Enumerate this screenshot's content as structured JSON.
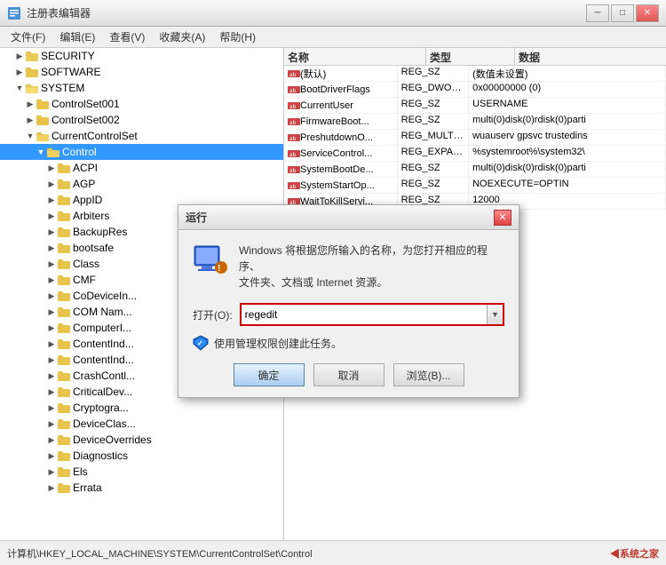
{
  "window": {
    "title": "注册表编辑器",
    "min_label": "─",
    "max_label": "□",
    "close_label": "✕"
  },
  "menu": {
    "items": [
      "文件(F)",
      "编辑(E)",
      "查看(V)",
      "收藏夹(A)",
      "帮助(H)"
    ]
  },
  "tree": {
    "items": [
      {
        "id": "security",
        "label": "SECURITY",
        "indent": 1,
        "expanded": false,
        "selected": false
      },
      {
        "id": "software",
        "label": "SOFTWARE",
        "indent": 1,
        "expanded": false,
        "selected": false
      },
      {
        "id": "system",
        "label": "SYSTEM",
        "indent": 1,
        "expanded": true,
        "selected": false
      },
      {
        "id": "controlset001",
        "label": "ControlSet001",
        "indent": 2,
        "expanded": false,
        "selected": false
      },
      {
        "id": "controlset002",
        "label": "ControlSet002",
        "indent": 2,
        "expanded": false,
        "selected": false
      },
      {
        "id": "currentcontrolset",
        "label": "CurrentControlSet",
        "indent": 2,
        "expanded": true,
        "selected": false
      },
      {
        "id": "control",
        "label": "Control",
        "indent": 3,
        "expanded": true,
        "selected": true
      },
      {
        "id": "acpi",
        "label": "ACPI",
        "indent": 4,
        "expanded": false,
        "selected": false
      },
      {
        "id": "agp",
        "label": "AGP",
        "indent": 4,
        "expanded": false,
        "selected": false
      },
      {
        "id": "appid",
        "label": "AppID",
        "indent": 4,
        "expanded": false,
        "selected": false
      },
      {
        "id": "arbiters",
        "label": "Arbiters",
        "indent": 4,
        "expanded": false,
        "selected": false
      },
      {
        "id": "backupres",
        "label": "BackupRes",
        "indent": 4,
        "expanded": false,
        "selected": false
      },
      {
        "id": "bootsafe",
        "label": "bootsafe",
        "indent": 4,
        "expanded": false,
        "selected": false
      },
      {
        "id": "class",
        "label": "Class",
        "indent": 4,
        "expanded": false,
        "selected": false
      },
      {
        "id": "cmf",
        "label": "CMF",
        "indent": 4,
        "expanded": false,
        "selected": false
      },
      {
        "id": "codevicein",
        "label": "CoDeviceIn...",
        "indent": 4,
        "expanded": false,
        "selected": false
      },
      {
        "id": "comnam",
        "label": "COM Nam...",
        "indent": 4,
        "expanded": false,
        "selected": false
      },
      {
        "id": "computeri",
        "label": "ComputerI...",
        "indent": 4,
        "expanded": false,
        "selected": false
      },
      {
        "id": "contentind1",
        "label": "ContentInd...",
        "indent": 4,
        "expanded": false,
        "selected": false
      },
      {
        "id": "contentind2",
        "label": "ContentInd...",
        "indent": 4,
        "expanded": false,
        "selected": false
      },
      {
        "id": "crashcontl",
        "label": "CrashContl...",
        "indent": 4,
        "expanded": false,
        "selected": false
      },
      {
        "id": "criticaldev",
        "label": "CriticalDev...",
        "indent": 4,
        "expanded": false,
        "selected": false
      },
      {
        "id": "cryptogra",
        "label": "Cryptogra...",
        "indent": 4,
        "expanded": false,
        "selected": false
      },
      {
        "id": "deviceclas",
        "label": "DeviceClas...",
        "indent": 4,
        "expanded": false,
        "selected": false
      },
      {
        "id": "deviceoverrides",
        "label": "DeviceOverrides",
        "indent": 4,
        "expanded": false,
        "selected": false
      },
      {
        "id": "diagnostics",
        "label": "Diagnostics",
        "indent": 4,
        "expanded": false,
        "selected": false
      },
      {
        "id": "els",
        "label": "Els",
        "indent": 4,
        "expanded": false,
        "selected": false
      },
      {
        "id": "errata",
        "label": "Errata",
        "indent": 4,
        "expanded": false,
        "selected": false
      }
    ]
  },
  "list": {
    "headers": [
      "名称",
      "类型",
      "数据"
    ],
    "rows": [
      {
        "name": "(默认)",
        "type": "REG_SZ",
        "data": "(数值未设置)"
      },
      {
        "name": "BootDriverFlags",
        "type": "REG_DWORD",
        "data": "0x00000000 (0)"
      },
      {
        "name": "CurrentUser",
        "type": "REG_SZ",
        "data": "USERNAME"
      },
      {
        "name": "FirmwareBoot...",
        "type": "REG_SZ",
        "data": "multi(0)disk(0)rdisk(0)parti"
      },
      {
        "name": "PreshutdownO...",
        "type": "REG_MULTI_SZ",
        "data": "wuauserv gpsvc trustedins"
      },
      {
        "name": "ServiceControl...",
        "type": "REG_EXPAND_SZ",
        "data": "%systemroot%\\system32\\"
      },
      {
        "name": "SystemBootDe...",
        "type": "REG_SZ",
        "data": "multi(0)disk(0)rdisk(0)parti"
      },
      {
        "name": "SystemStartOp...",
        "type": "REG_SZ",
        "data": "NOEXECUTE=OPTIN"
      },
      {
        "name": "WaitToKillServi...",
        "type": "REG_SZ",
        "data": "12000"
      }
    ]
  },
  "status": {
    "path": "计算机\\HKEY_LOCAL_MACHINE\\SYSTEM\\CurrentControlSet\\Control",
    "logo": "◀系统之家"
  },
  "dialog": {
    "title": "运行",
    "close": "✕",
    "description": "Windows 将根据您所输入的名称，为您打开相应的程序、\n文件夹、文档或 Internet 资源。",
    "open_label": "打开(O):",
    "input_value": "regedit",
    "dropdown_arrow": "▼",
    "checkbox_text": "使用管理权限创建此任务。",
    "btn_ok": "确定",
    "btn_cancel": "取消",
    "btn_browse": "浏览(B)..."
  }
}
